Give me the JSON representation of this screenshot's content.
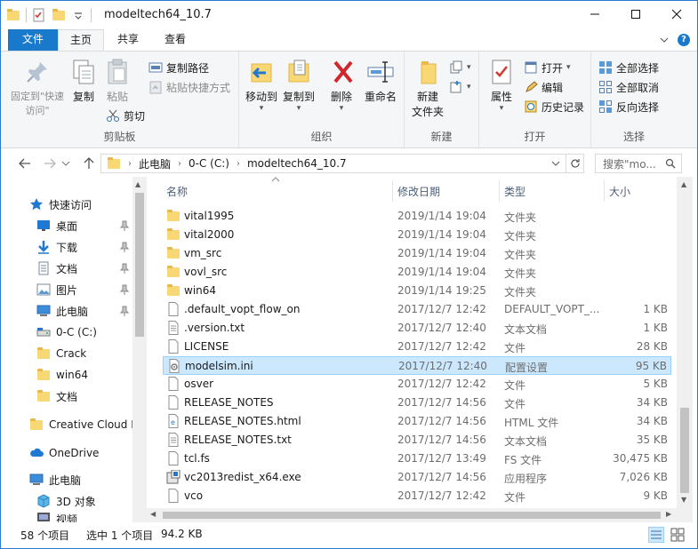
{
  "window": {
    "title": "modeltech64_10.7",
    "minimize_icon": "minimize-icon",
    "maximize_icon": "maximize-icon",
    "close_icon": "close-icon"
  },
  "tabs": {
    "file": "文件",
    "home": "主页",
    "share": "共享",
    "view": "查看"
  },
  "ribbon": {
    "clipboard": {
      "label": "剪贴板",
      "pin": "固定到\"快速访问\"",
      "copy": "复制",
      "paste": "粘贴",
      "copy_path": "复制路径",
      "paste_shortcut": "粘贴快捷方式",
      "cut": "剪切"
    },
    "organize": {
      "label": "组织",
      "move_to": "移动到",
      "copy_to": "复制到",
      "delete": "删除",
      "rename": "重命名"
    },
    "new": {
      "label": "新建",
      "new_folder": "新建\n文件夹"
    },
    "open": {
      "label": "打开",
      "properties": "属性",
      "open": "打开",
      "edit": "编辑",
      "history": "历史记录"
    },
    "select": {
      "label": "选择",
      "select_all": "全部选择",
      "select_none": "全部取消",
      "invert": "反向选择"
    }
  },
  "address": {
    "crumbs": [
      "此电脑",
      "0-C (C:)",
      "modeltech64_10.7"
    ],
    "search_placeholder": "搜索\"mo..."
  },
  "nav": {
    "quick_access": "快速访问",
    "items": [
      {
        "label": "桌面",
        "icon": "desktop-icon",
        "pinned": true
      },
      {
        "label": "下载",
        "icon": "download-icon",
        "pinned": true
      },
      {
        "label": "文档",
        "icon": "documents-icon",
        "pinned": true
      },
      {
        "label": "图片",
        "icon": "pictures-icon",
        "pinned": true
      },
      {
        "label": "此电脑",
        "icon": "computer-icon",
        "pinned": true
      },
      {
        "label": "0-C (C:)",
        "icon": "drive-icon",
        "pinned": false
      },
      {
        "label": "Crack",
        "icon": "folder-icon",
        "pinned": false
      },
      {
        "label": "win64",
        "icon": "folder-icon",
        "pinned": false
      },
      {
        "label": "文档",
        "icon": "folder-icon",
        "pinned": false
      }
    ],
    "creative_cloud": "Creative Cloud F",
    "onedrive": "OneDrive",
    "this_pc": "此电脑",
    "objects3d": "3D 对象",
    "videos": "视频"
  },
  "columns": {
    "name": "名称",
    "date": "修改日期",
    "type": "类型",
    "size": "大小"
  },
  "files": [
    {
      "name": "vital1995",
      "date": "2019/1/14 19:04",
      "type": "文件夹",
      "size": "",
      "icon": "folder"
    },
    {
      "name": "vital2000",
      "date": "2019/1/14 19:04",
      "type": "文件夹",
      "size": "",
      "icon": "folder"
    },
    {
      "name": "vm_src",
      "date": "2019/1/14 19:04",
      "type": "文件夹",
      "size": "",
      "icon": "folder"
    },
    {
      "name": "vovl_src",
      "date": "2019/1/14 19:04",
      "type": "文件夹",
      "size": "",
      "icon": "folder"
    },
    {
      "name": "win64",
      "date": "2019/1/14 19:25",
      "type": "文件夹",
      "size": "",
      "icon": "folder"
    },
    {
      "name": ".default_vopt_flow_on",
      "date": "2017/12/7 12:42",
      "type": "DEFAULT_VOPT_...",
      "size": "1 KB",
      "icon": "file"
    },
    {
      "name": ".version.txt",
      "date": "2017/12/7 12:40",
      "type": "文本文档",
      "size": "1 KB",
      "icon": "text"
    },
    {
      "name": "LICENSE",
      "date": "2017/12/7 12:42",
      "type": "文件",
      "size": "28 KB",
      "icon": "file"
    },
    {
      "name": "modelsim.ini",
      "date": "2017/12/7 12:40",
      "type": "配置设置",
      "size": "95 KB",
      "icon": "config",
      "selected": true
    },
    {
      "name": "osver",
      "date": "2017/12/7 12:42",
      "type": "文件",
      "size": "5 KB",
      "icon": "file"
    },
    {
      "name": "RELEASE_NOTES",
      "date": "2017/12/7 14:56",
      "type": "文件",
      "size": "34 KB",
      "icon": "file"
    },
    {
      "name": "RELEASE_NOTES.html",
      "date": "2017/12/7 14:56",
      "type": "HTML 文件",
      "size": "34 KB",
      "icon": "html"
    },
    {
      "name": "RELEASE_NOTES.txt",
      "date": "2017/12/7 14:56",
      "type": "文本文档",
      "size": "35 KB",
      "icon": "text"
    },
    {
      "name": "tcl.fs",
      "date": "2017/12/7 13:49",
      "type": "FS 文件",
      "size": "30,475 KB",
      "icon": "file"
    },
    {
      "name": "vc2013redist_x64.exe",
      "date": "2017/12/7 14:56",
      "type": "应用程序",
      "size": "7,026 KB",
      "icon": "exe"
    },
    {
      "name": "vco",
      "date": "2017/12/7 12:42",
      "type": "文件",
      "size": "9 KB",
      "icon": "file"
    }
  ],
  "status": {
    "count": "58 个项目",
    "selected": "选中 1 个项目",
    "size": "94.2 KB"
  },
  "colors": {
    "accent": "#1979ca",
    "selection": "#cce8ff",
    "folder": "#f8d775"
  }
}
